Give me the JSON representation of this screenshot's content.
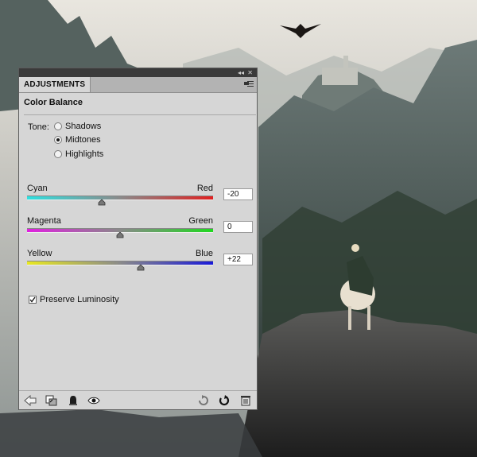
{
  "panel": {
    "tab_label": "ADJUSTMENTS",
    "collapse_glyph": "◂◂",
    "close_glyph": "✕",
    "heading": "Color Balance"
  },
  "tone": {
    "label": "Tone:",
    "options": [
      "Shadows",
      "Midtones",
      "Highlights"
    ],
    "selected": "Midtones"
  },
  "sliders": [
    {
      "left": "Cyan",
      "right": "Red",
      "value": "-20",
      "level": -20,
      "left_color": "#2fe0e0",
      "right_color": "#e02020"
    },
    {
      "left": "Magenta",
      "right": "Green",
      "value": "0",
      "level": 0,
      "left_color": "#e020e0",
      "right_color": "#20d820"
    },
    {
      "left": "Yellow",
      "right": "Blue",
      "value": "+22",
      "level": 22,
      "left_color": "#e8e820",
      "right_color": "#1a1ad8"
    }
  ],
  "preserve_luminosity": {
    "label": "Preserve Luminosity",
    "checked": true
  },
  "footer_icons": [
    "back-arrow-icon",
    "clip-to-layer-icon",
    "mask-icon",
    "visibility-eye-icon",
    "view-previous-icon",
    "reset-icon",
    "trash-icon"
  ]
}
